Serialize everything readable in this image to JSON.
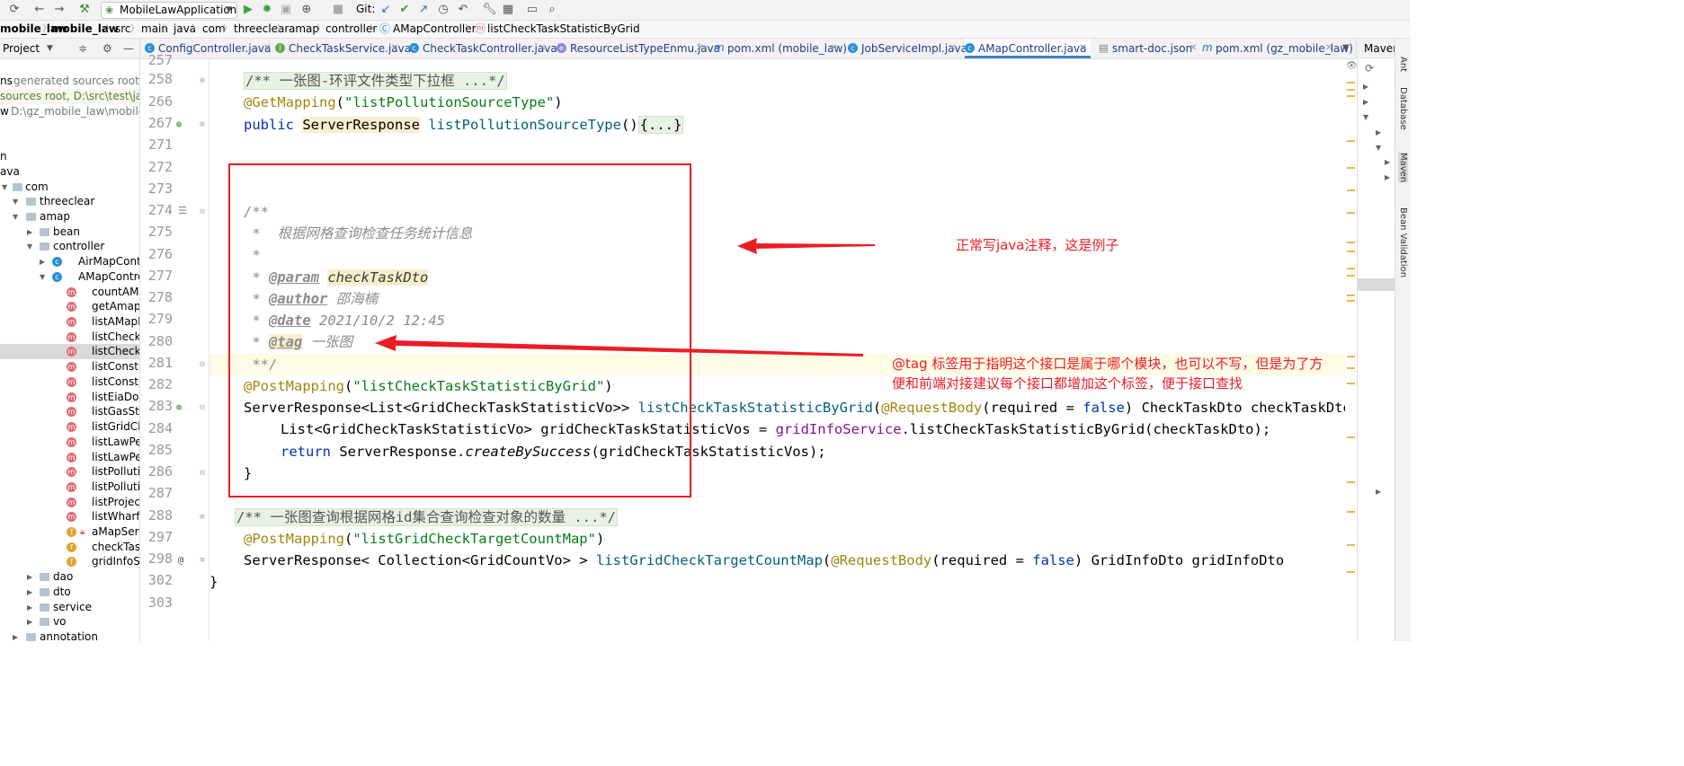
{
  "toolbar": {
    "run_config": "MobileLawApplication",
    "git_label": "Git:"
  },
  "breadcrumb": [
    "mobile_law",
    "mobile_law",
    "src",
    "main",
    "java",
    "com",
    "threeclear",
    "amap",
    "controller",
    "AMapController",
    "listCheckTaskStatisticByGrid"
  ],
  "project_header": {
    "label": "Project"
  },
  "maven_header": {
    "label": "Maven"
  },
  "tabs": [
    {
      "label": "ConfigController.java",
      "icon": "c"
    },
    {
      "label": "CheckTaskService.java",
      "icon": "i"
    },
    {
      "label": "CheckTaskController.java",
      "icon": "c"
    },
    {
      "label": "ResourceListTypeEnmu.java",
      "icon": "e"
    },
    {
      "label": "pom.xml (mobile_law)",
      "icon": "m"
    },
    {
      "label": "JobServiceImpl.java",
      "icon": "c"
    },
    {
      "label": "AMapController.java",
      "icon": "c",
      "active": true
    },
    {
      "label": "smart-doc.json",
      "icon": "json"
    },
    {
      "label": "pom.xml (gz_mobile_law)",
      "icon": "m"
    }
  ],
  "tree": {
    "top_items": [
      {
        "label": "ns",
        "muted": "generated sources root, D:\\"
      },
      {
        "label": "",
        "muted": "sources root, D:\\src\\test\\java"
      },
      {
        "label": "w",
        "muted": "D:\\gz_mobile_law\\mobile_law"
      }
    ],
    "rows": {
      "n": "n",
      "java": "ava",
      "com": "com",
      "threeclear": "threeclear",
      "amap": "amap",
      "bean": "bean",
      "controller": "controller",
      "airmap": "AirMapContro",
      "amapcontroller": "AMapControl",
      "m1": "countAMap",
      "m2": "getAmapT",
      "m3": "listAMapD",
      "m4": "listCheckTa",
      "m5": "listCheckTa",
      "m6": "listConstru",
      "m7": "listConstru",
      "m8": "listEiaDocu",
      "m9": "listGasStat",
      "m10": "listGridChe",
      "m11": "listLawPers",
      "m12": "listLawPers",
      "m13": "listPollutio",
      "m14": "listPollutio",
      "m15": "listProjectS",
      "m16": "listWharfLi",
      "f1": "aMapServ",
      "f2": "checkTask",
      "f3": "gridInfoSe",
      "dao": "dao",
      "dto": "dto",
      "service": "service",
      "vo": "vo",
      "annotation": "annotation"
    }
  },
  "gutter": {
    "lines": [
      "257",
      "258",
      "266",
      "267",
      "271",
      "272",
      "273",
      "274",
      "275",
      "276",
      "277",
      "278",
      "279",
      "280",
      "281",
      "282",
      "283",
      "284",
      "285",
      "286",
      "287",
      "288",
      "297",
      "298",
      "302",
      "303"
    ]
  },
  "code": {
    "l258_fold": "/** 一张图-环评文件类型下拉框 ...*/",
    "l266_ann": "@GetMapping",
    "l266_str": "\"listPollutionSourceType\"",
    "l267_kw": "public",
    "l267_type": "ServerResponse",
    "l267_fn": "listPollutionSourceType",
    "l267_fold": "{...}",
    "l274": "/**",
    "l275": " *  根据网格查询检查任务统计信息",
    "l276": " *",
    "l277_tag": "@param",
    "l277_val": "checkTaskDto",
    "l278_tag": "@author",
    "l278_val": "邵海楠",
    "l279_tag": "@date",
    "l279_val": "2021/10/2 12:45",
    "l280_tag": "@tag",
    "l280_val": "一张图",
    "l281": " **/",
    "l282_ann": "@PostMapping",
    "l282_str": "\"listCheckTaskStatisticByGrid\"",
    "l283_type": "ServerResponse<List<GridCheckTaskStatisticVo>>",
    "l283_fn": "listCheckTaskStatisticByGrid",
    "l283_ann": "@RequestBody",
    "l283_required": "required = ",
    "l283_false": "false",
    "l283_tail": ") CheckTaskDto checkTaskDto",
    "l284_type": "List<GridCheckTaskStatisticVo> gridCheckTaskStatisticVos = ",
    "l284_field": "gridInfoService",
    "l284_tail": ".listCheckTaskStatisticByGrid(checkTaskDto);",
    "l285_kw": "return",
    "l285_cls": "ServerResponse.",
    "l285_fn": "createBySuccess",
    "l285_tail": "(gridCheckTaskStatisticVos);",
    "l286": "}",
    "l288_fold": "/** 一张图查询根据网格id集合查询检查对象的数量 ...*/",
    "l297_ann": "@PostMapping",
    "l297_str": "\"listGridCheckTargetCountMap\"",
    "l298_type": "ServerResponse< Collection<GridCountVo> > ",
    "l298_fn": "listGridCheckTargetCountMap",
    "l298_ann": "@RequestBody",
    "l298_required": "required = ",
    "l298_false": "false",
    "l298_tail": ") GridInfoDto gridInfoDto",
    "l302": "}"
  },
  "annotations": {
    "note1": "正常写java注释，这是例子",
    "note2_line1": "@tag 标签用于指明这个接口是属于哪个模块，也可以不写，但是为了方",
    "note2_line2": "便和前端对接建议每个接口都增加这个标签，便于接口查找",
    "color": "#ec1c24"
  },
  "side_tools": [
    "Ant",
    "Database",
    "Maven",
    "Bean Validation"
  ]
}
